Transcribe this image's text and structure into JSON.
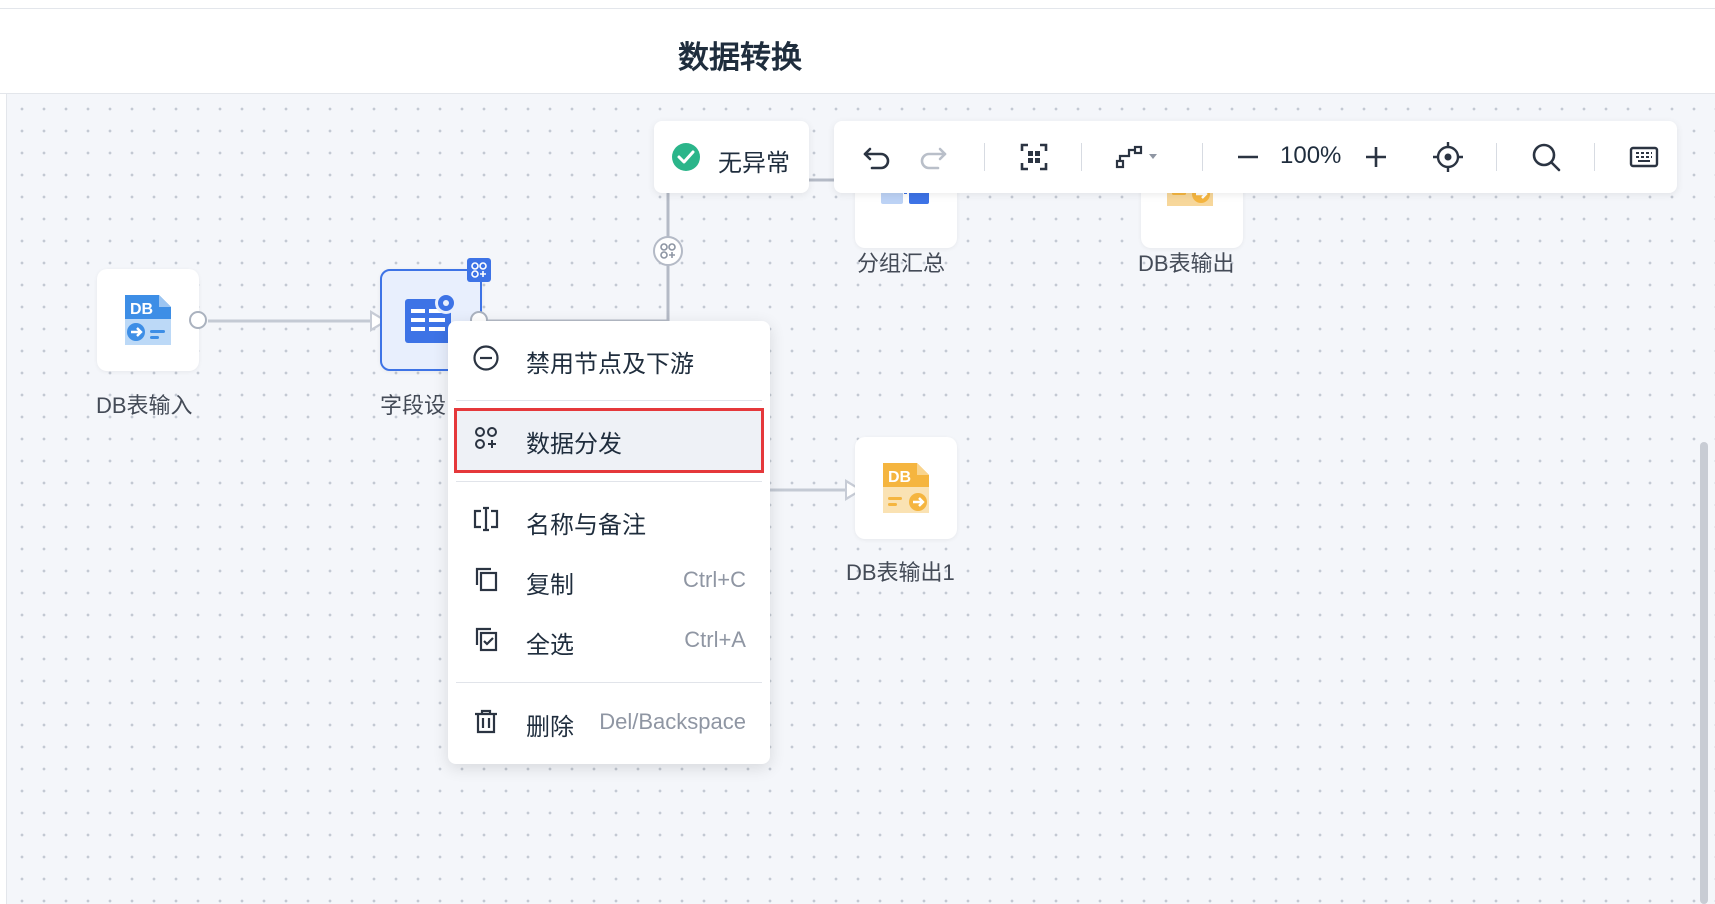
{
  "header": {
    "title": "数据转换"
  },
  "status": {
    "label": "无异常"
  },
  "toolbar": {
    "zoom": "100%"
  },
  "nodes": {
    "db_input": {
      "label": "DB表输入"
    },
    "field_setting": {
      "label": "字段设"
    },
    "group_summary": {
      "label": "分组汇总"
    },
    "db_output": {
      "label": "DB表输出"
    },
    "db_output1": {
      "label": "DB表输出1"
    }
  },
  "context_menu": {
    "items": [
      {
        "label": "禁用节点及下游",
        "shortcut": "",
        "icon": "minus-circle-icon"
      },
      {
        "label": "数据分发",
        "shortcut": "",
        "icon": "distribute-icon",
        "highlighted": true
      },
      {
        "label": "名称与备注",
        "shortcut": "",
        "icon": "rename-icon"
      },
      {
        "label": "复制",
        "shortcut": "Ctrl+C",
        "icon": "copy-icon"
      },
      {
        "label": "全选",
        "shortcut": "Ctrl+A",
        "icon": "select-all-icon"
      },
      {
        "label": "删除",
        "shortcut": "Del/Backspace",
        "icon": "trash-icon"
      }
    ]
  },
  "colors": {
    "accent": "#3d73e6",
    "highlight_border": "#e5383b",
    "status_ok": "#2bb58a",
    "db_input": "#3d8ee6",
    "db_output": "#f5b53f"
  }
}
